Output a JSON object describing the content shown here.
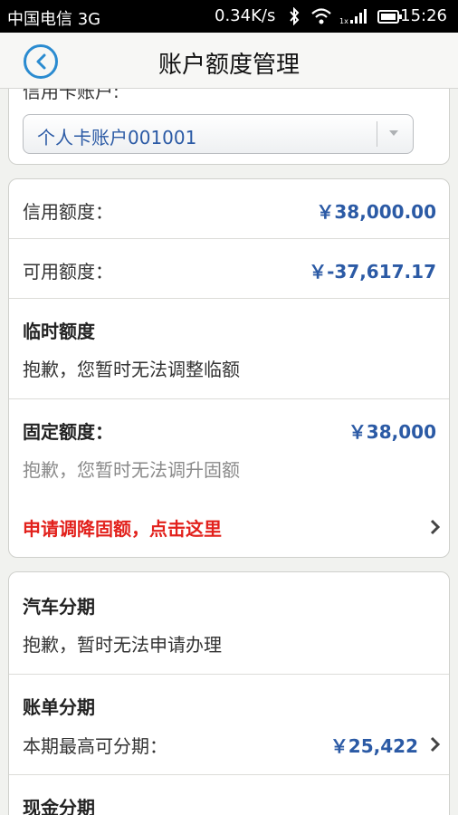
{
  "status_bar": {
    "carrier": "中国电信 3G",
    "speed": "0.34K/s",
    "time": "15:26"
  },
  "header": {
    "title": "账户额度管理"
  },
  "account": {
    "label": "信用卡账户:",
    "selected": "个人卡账户001001"
  },
  "limits": {
    "credit_label": "信用额度：",
    "credit_value": "￥38,000.00",
    "available_label": "可用额度：",
    "available_value": "￥-37,617.17",
    "temp_title": "临时额度",
    "temp_message": "抱歉，您暂时无法调整临额",
    "fixed_title": "固定额度：",
    "fixed_value": "￥38,000",
    "fixed_message": "抱歉，您暂时无法调升固额",
    "fixed_action": "申请调降固额，点击这里"
  },
  "installments": {
    "car_title": "汽车分期",
    "car_message": "抱歉，暂时无法申请办理",
    "bill_title": "账单分期",
    "bill_label": "本期最高可分期：",
    "bill_value": "￥25,422",
    "cash_title": "现金分期"
  }
}
